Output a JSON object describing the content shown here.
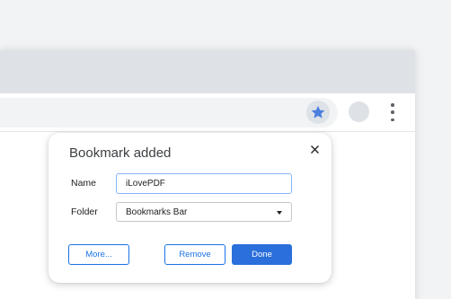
{
  "dialog": {
    "title": "Bookmark added",
    "name_label": "Name",
    "name_value": "iLovePDF",
    "folder_label": "Folder",
    "folder_value": "Bookmarks Bar",
    "more_label": "More...",
    "remove_label": "Remove",
    "done_label": "Done"
  },
  "toolbar": {
    "star_icon": "star-icon",
    "menu_icon": "kebab-menu-icon"
  },
  "colors": {
    "accent": "#1a73e8",
    "done_bg": "#2a6fdb",
    "star_fill": "#4a7fde"
  }
}
